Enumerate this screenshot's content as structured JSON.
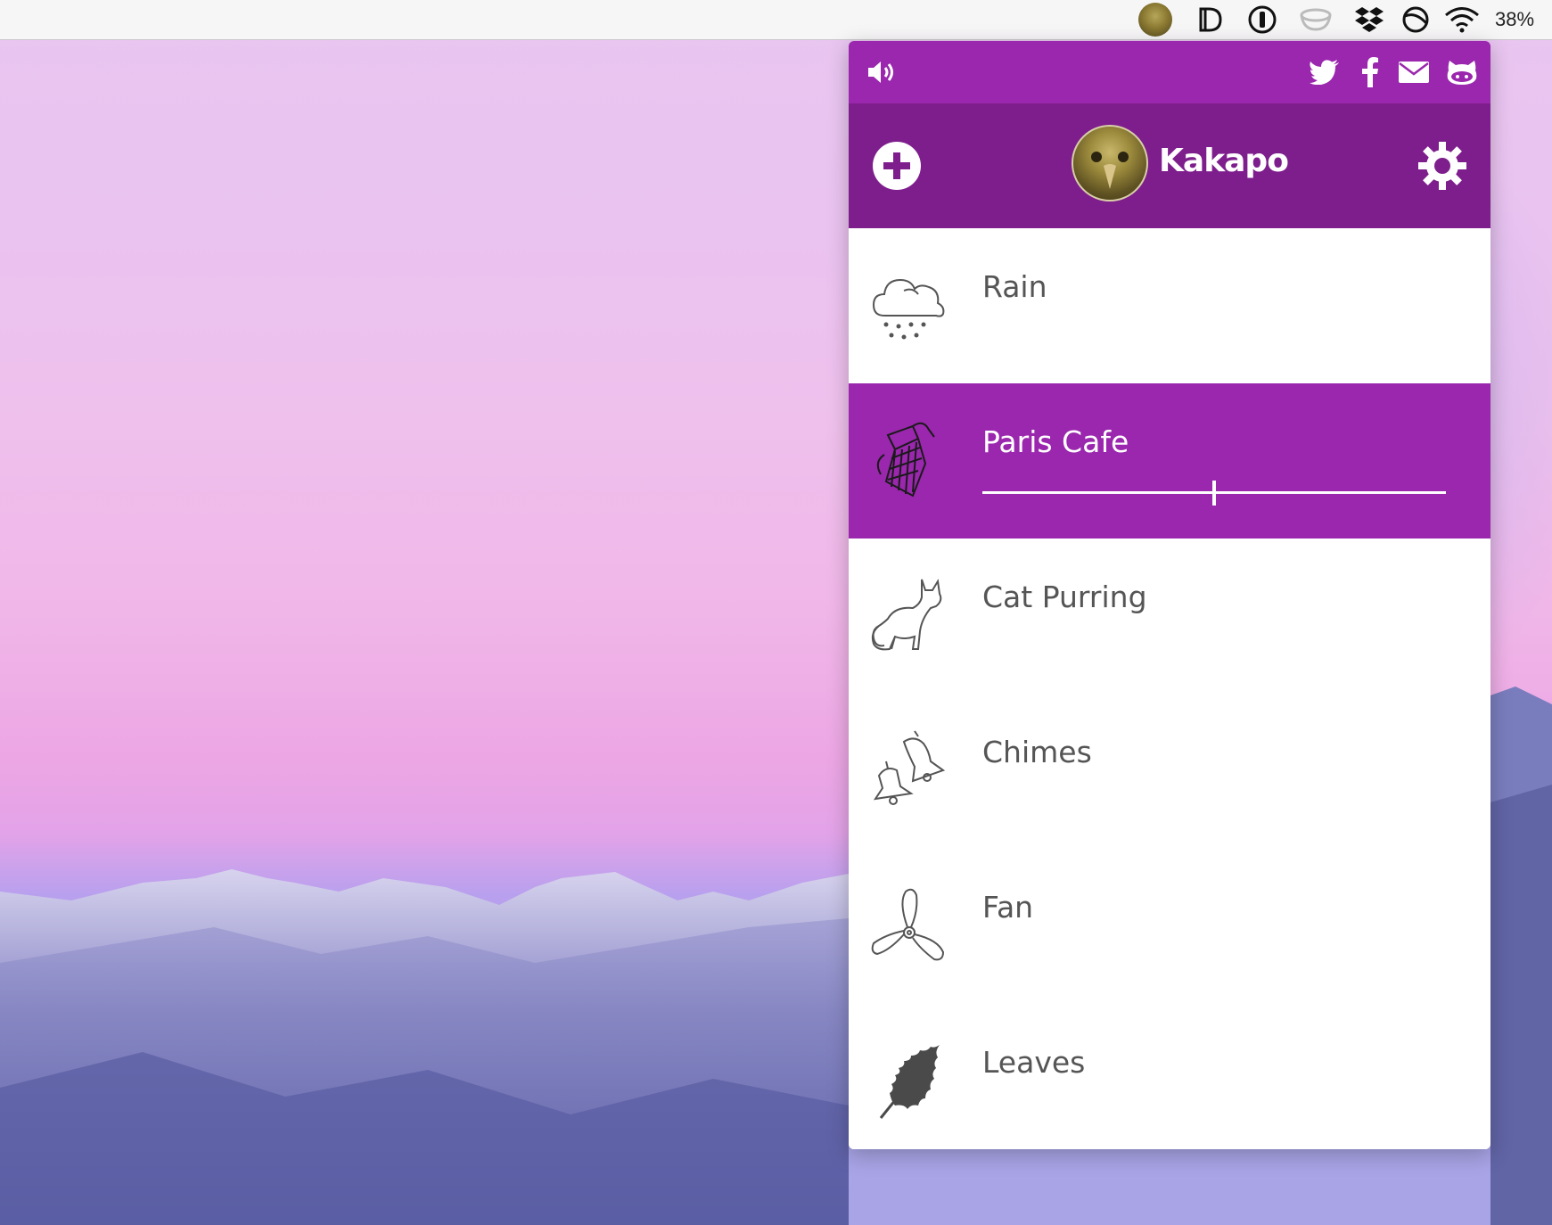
{
  "menubar": {
    "items": [
      "kakapo-avatar",
      "d-icon",
      "1password-icon",
      "coffee-cup-icon",
      "dropbox-icon",
      "sync-icon",
      "wifi-icon"
    ],
    "battery": "38%"
  },
  "app": {
    "username": "Kakapo",
    "accent_color": "#9a27ad",
    "header_color": "#7e1e8d",
    "social": [
      "twitter-icon",
      "facebook-icon",
      "mail-icon",
      "github-icon"
    ]
  },
  "sounds": [
    {
      "label": "Rain",
      "icon": "rain-cloud-icon",
      "active": false
    },
    {
      "label": "Paris Cafe",
      "icon": "coffee-pot-icon",
      "active": true,
      "volume": 0.5
    },
    {
      "label": "Cat Purring",
      "icon": "cat-icon",
      "active": false
    },
    {
      "label": "Chimes",
      "icon": "bells-icon",
      "active": false
    },
    {
      "label": "Fan",
      "icon": "fan-icon",
      "active": false
    },
    {
      "label": "Leaves",
      "icon": "leaf-icon",
      "active": false
    }
  ]
}
